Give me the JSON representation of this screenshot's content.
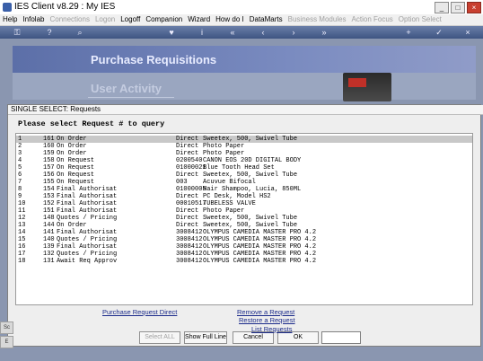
{
  "window": {
    "title": "IES Client v8.29 : My IES"
  },
  "menu": [
    {
      "label": "Help",
      "disabled": false
    },
    {
      "label": "Infolab",
      "disabled": false
    },
    {
      "label": "Connections",
      "disabled": true
    },
    {
      "label": "Logon",
      "disabled": true
    },
    {
      "label": "Logoff",
      "disabled": false
    },
    {
      "label": "Companion",
      "disabled": false
    },
    {
      "label": "Wizard",
      "disabled": false
    },
    {
      "label": "How do I",
      "disabled": false
    },
    {
      "label": "DataMarts",
      "disabled": false
    },
    {
      "label": "Business Modules",
      "disabled": true
    },
    {
      "label": "Action Focus",
      "disabled": true
    },
    {
      "label": "Option Select",
      "disabled": true
    }
  ],
  "header": {
    "title": "Purchase Requisitions",
    "subtitle": "User Activity"
  },
  "dialog": {
    "title": "SINGLE SELECT: Requests",
    "prompt": "Please select Request # to query",
    "rows": [
      {
        "idx": "1",
        "num": "161",
        "status": "On Order",
        "type": "Direct",
        "desc": "Sweetex, 500, Swivel Tube"
      },
      {
        "idx": "2",
        "num": "160",
        "status": "On Order",
        "type": "Direct",
        "desc": "Photo Paper"
      },
      {
        "idx": "3",
        "num": "159",
        "status": "On Order",
        "type": "Direct",
        "desc": "Photo Paper"
      },
      {
        "idx": "4",
        "num": "158",
        "status": "On Request",
        "type": "0200540",
        "desc": "CANON EOS 20D DIGITAL BODY"
      },
      {
        "idx": "5",
        "num": "157",
        "status": "On Request",
        "type": "01000021",
        "desc": "Blue Tooth Head Set"
      },
      {
        "idx": "6",
        "num": "156",
        "status": "On Request",
        "type": "Direct",
        "desc": "Sweetex, 500, Swivel Tube"
      },
      {
        "idx": "7",
        "num": "155",
        "status": "On Request",
        "type": "003",
        "desc": "Acuvue Bifocal"
      },
      {
        "idx": "8",
        "num": "154",
        "status": "Final Authorisat",
        "type": "01000005",
        "desc": "Hair Shampoo, Lucia, 850ML"
      },
      {
        "idx": "9",
        "num": "153",
        "status": "Final Authorisat",
        "type": "Direct",
        "desc": "PC Desk, Model HS2"
      },
      {
        "idx": "10",
        "num": "152",
        "status": "Final Authorisat",
        "type": "00010517",
        "desc": "TUBELESS VALVE"
      },
      {
        "idx": "11",
        "num": "151",
        "status": "Final Authorisat",
        "type": "Direct",
        "desc": "Photo Paper"
      },
      {
        "idx": "12",
        "num": "148",
        "status": "Quotes / Pricing",
        "type": "Direct",
        "desc": "Sweetex, 500, Swivel Tube"
      },
      {
        "idx": "13",
        "num": "144",
        "status": "On Order",
        "type": "Direct",
        "desc": "Sweetex, 500, Swivel Tube"
      },
      {
        "idx": "14",
        "num": "141",
        "status": "Final Authorisat",
        "type": "3008412",
        "desc": "OLYMPUS CAMEDIA MASTER PRO 4.2"
      },
      {
        "idx": "15",
        "num": "140",
        "status": "Quotes / Pricing",
        "type": "3008412",
        "desc": "OLYMPUS CAMEDIA MASTER PRO 4.2"
      },
      {
        "idx": "16",
        "num": "139",
        "status": "Final Authorisat",
        "type": "3008412",
        "desc": "OLYMPUS CAMEDIA MASTER PRO 4.2"
      },
      {
        "idx": "17",
        "num": "132",
        "status": "Quotes / Pricing",
        "type": "3008412",
        "desc": "OLYMPUS CAMEDIA MASTER PRO 4.2"
      },
      {
        "idx": "18",
        "num": "131",
        "status": "Await Req Approv",
        "type": "3008412",
        "desc": "OLYMPUS CAMEDIA MASTER PRO 4.2"
      }
    ],
    "buttons": {
      "select_all": "Select ALL",
      "show_full_line": "Show Full Line",
      "cancel": "Cancel",
      "ok": "OK"
    },
    "input_value": ""
  },
  "links": {
    "purchase_direct": "Purchase Request Direct",
    "remove": "Remove a Request",
    "restore": "Restore a Request",
    "list": "List Requests"
  },
  "colors": {
    "banner": "#5c6fa8",
    "selection": "#c8c8c8",
    "link": "#1a2a8a"
  }
}
